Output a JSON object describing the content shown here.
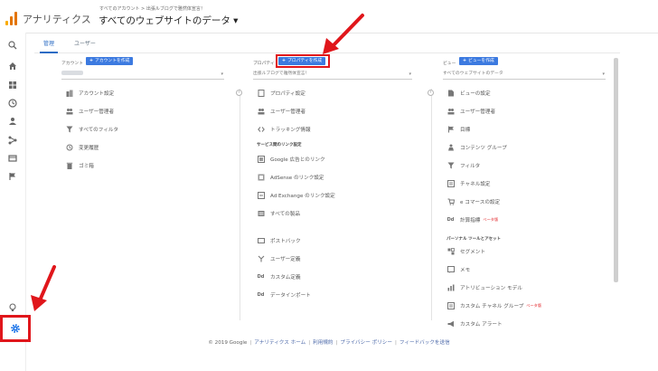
{
  "header": {
    "app_title": "アナリティクス",
    "breadcrumb": "すべてのアカウント > 出張ルブログで雅然体宣言！",
    "property_title": "すべてのウェブサイトのデータ ▾"
  },
  "tabs": [
    {
      "label": "管理",
      "active": true
    },
    {
      "label": "ユーザー",
      "active": false
    }
  ],
  "account": {
    "label": "アカウント",
    "create_button": "アカウントを作成",
    "items": [
      {
        "icon": "building-icon",
        "label": "アカウント設定"
      },
      {
        "icon": "users-icon",
        "label": "ユーザー管理者"
      },
      {
        "icon": "filter-icon",
        "label": "すべてのフィルタ"
      },
      {
        "icon": "history-icon",
        "label": "変更履歴"
      },
      {
        "icon": "trash-icon",
        "label": "ゴミ箱"
      }
    ]
  },
  "property": {
    "label": "プロパティ",
    "create_button": "プロパティを作成",
    "selected": "出張ルブログで雅然体宣言！",
    "items": [
      {
        "icon": "document-icon",
        "label": "プロパティ設定"
      },
      {
        "icon": "users-icon",
        "label": "ユーザー管理者"
      },
      {
        "icon": "code-icon",
        "label": "トラッキング情報"
      }
    ],
    "section_heading": "サービス間のリンク設定",
    "links": [
      {
        "icon": "ads-icon",
        "label": "Google 広告とのリンク"
      },
      {
        "icon": "adsense-icon",
        "label": "AdSense のリンク設定"
      },
      {
        "icon": "adexchange-icon",
        "label": "Ad Exchange のリンク設定"
      },
      {
        "icon": "products-icon",
        "label": "すべての製品"
      }
    ],
    "more": [
      {
        "icon": "postback-icon",
        "label": "ポストバック"
      },
      {
        "icon": "fork-icon",
        "label": "ユーザー定義"
      },
      {
        "icon": "dd-icon",
        "label": "カスタム定義"
      },
      {
        "icon": "dd-icon",
        "label": "データインポート"
      }
    ]
  },
  "view": {
    "label": "ビュー",
    "create_button": "ビューを作成",
    "selected": "すべてのウェブサイトのデータ",
    "items": [
      {
        "icon": "document-icon",
        "label": "ビューの設定"
      },
      {
        "icon": "users-icon",
        "label": "ユーザー管理者"
      },
      {
        "icon": "flag-icon",
        "label": "目標"
      },
      {
        "icon": "person-icon",
        "label": "コンテンツ グループ"
      },
      {
        "icon": "filter-icon",
        "label": "フィルタ"
      },
      {
        "icon": "channel-icon",
        "label": "チャネル設定"
      },
      {
        "icon": "cart-icon",
        "label": "e コマースの設定"
      },
      {
        "icon": "dd-icon",
        "label": "計算指標",
        "badge": "ベータ版"
      }
    ],
    "section_heading": "パーソナル ツールとアセット",
    "tools": [
      {
        "icon": "segment-icon",
        "label": "セグメント"
      },
      {
        "icon": "memo-icon",
        "label": "メモ"
      },
      {
        "icon": "bars-icon",
        "label": "アトリビューション モデル"
      },
      {
        "icon": "channel-icon",
        "label": "カスタム チャネル グループ",
        "badge": "ベータ版"
      },
      {
        "icon": "megaphone-icon",
        "label": "カスタム アラート"
      }
    ]
  },
  "footer": {
    "copyright": "© 2019 Google",
    "links": [
      "アナリティクス ホーム",
      "利用規約",
      "プライバシー ポリシー",
      "フィードバックを送信"
    ]
  },
  "colors": {
    "accent": "#3c7ae0",
    "highlight": "#e0161b",
    "logo": [
      "#f9ab00",
      "#e37400",
      "#e37400"
    ]
  }
}
